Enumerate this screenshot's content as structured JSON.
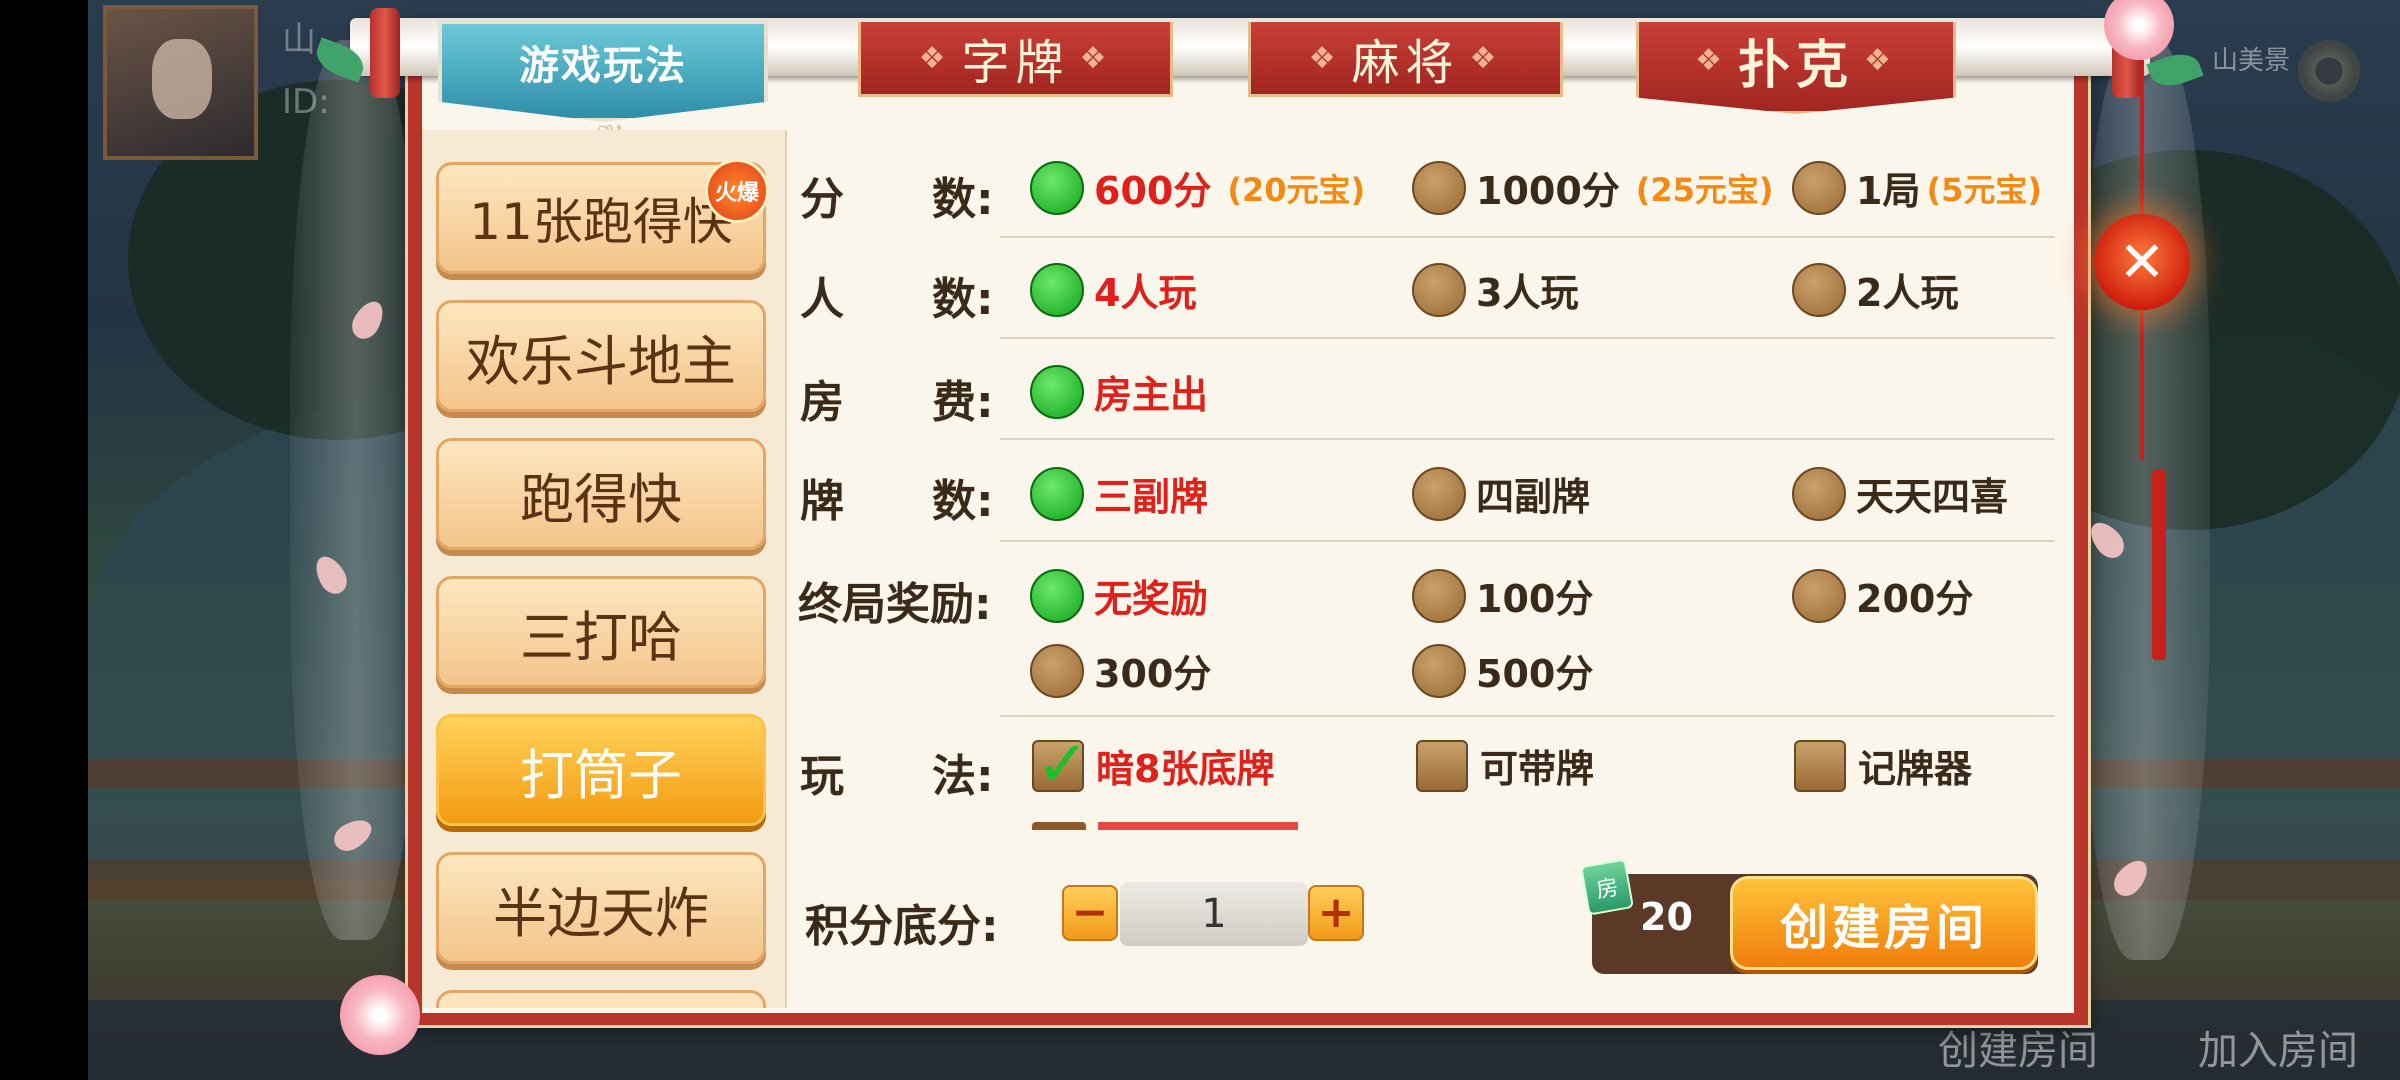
{
  "background": {
    "player_name_partial": "山",
    "player_id_partial": "ID:",
    "top_right_text": "山美景",
    "bottom_create_room": "创建房间",
    "bottom_join_room": "加入房间"
  },
  "tabs": {
    "play": "游戏玩法",
    "zipai": "字牌",
    "majiang": "麻将",
    "puke": "扑克"
  },
  "games": {
    "hot_badge": "火爆",
    "items": [
      {
        "label": "11张跑得快"
      },
      {
        "label": "欢乐斗地主"
      },
      {
        "label": "跑得快"
      },
      {
        "label": "三打哈"
      },
      {
        "label": "打筒子"
      },
      {
        "label": "半边天炸"
      }
    ],
    "active_label": "打筒子"
  },
  "settings": {
    "score": {
      "label": "分　　数:",
      "options": [
        {
          "text": "600分",
          "extra": "(20元宝)"
        },
        {
          "text": "1000分",
          "extra": "(25元宝)"
        },
        {
          "text": "1局",
          "extra": "(5元宝)"
        }
      ]
    },
    "players": {
      "label": "人　　数:",
      "options": [
        {
          "text": "4人玩"
        },
        {
          "text": "3人玩"
        },
        {
          "text": "2人玩"
        }
      ]
    },
    "fee": {
      "label": "房　　费:",
      "options": [
        {
          "text": "房主出"
        }
      ]
    },
    "decks": {
      "label": "牌　　数:",
      "options": [
        {
          "text": "三副牌"
        },
        {
          "text": "四副牌"
        },
        {
          "text": "天天四喜"
        }
      ]
    },
    "reward": {
      "label": "终局奖励:",
      "options": [
        {
          "text": "无奖励"
        },
        {
          "text": "100分"
        },
        {
          "text": "200分"
        },
        {
          "text": "300分"
        },
        {
          "text": "500分"
        }
      ]
    },
    "rules": {
      "label": "玩　　法:",
      "options": [
        {
          "text": "暗8张底牌"
        },
        {
          "text": "可带牌"
        },
        {
          "text": "记牌器"
        }
      ]
    }
  },
  "bottom": {
    "base_score_label": "积分底分:",
    "minus": "−",
    "plus": "+",
    "base_score_value": "1",
    "cost_icon": "房",
    "cost": "20",
    "create_button": "创建房间"
  },
  "colors": {
    "frame_red": "#b8352c",
    "selected_green": "#10a41a",
    "selected_text": "#e0201a",
    "accent_orange": "#f28a14"
  }
}
